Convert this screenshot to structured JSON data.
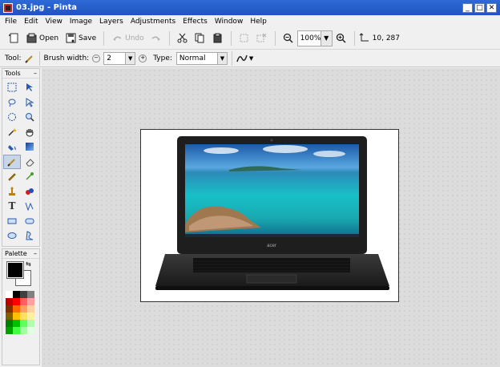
{
  "window": {
    "title": "03.jpg - Pinta"
  },
  "menu": [
    "File",
    "Edit",
    "View",
    "Image",
    "Layers",
    "Adjustments",
    "Effects",
    "Window",
    "Help"
  ],
  "toolbar": {
    "open_label": "Open",
    "save_label": "Save",
    "undo_label": "Undo",
    "zoom_value": "100%",
    "coords": "10, 287"
  },
  "options": {
    "tool_label": "Tool:",
    "brush_width_label": "Brush width:",
    "brush_width_value": "2",
    "type_label": "Type:",
    "type_value": "Normal"
  },
  "panels": {
    "tools_title": "Tools",
    "palette_title": "Palette"
  },
  "colors": {
    "primary": "#000000",
    "secondary": "#ffffff",
    "titlebar": "#2462cc",
    "palette": [
      "#ffffff",
      "#000000",
      "#404040",
      "#808080",
      "#c00000",
      "#ff0000",
      "#ff6060",
      "#ffa0a0",
      "#803000",
      "#ff6a00",
      "#ffa060",
      "#ffd0a0",
      "#806000",
      "#ffc000",
      "#ffe060",
      "#fff0a0",
      "#008000",
      "#00c000",
      "#60ff60",
      "#b0ffb0",
      "#00a000",
      "#40ff40",
      "#a0ffa0",
      "#e0ffe0"
    ]
  }
}
